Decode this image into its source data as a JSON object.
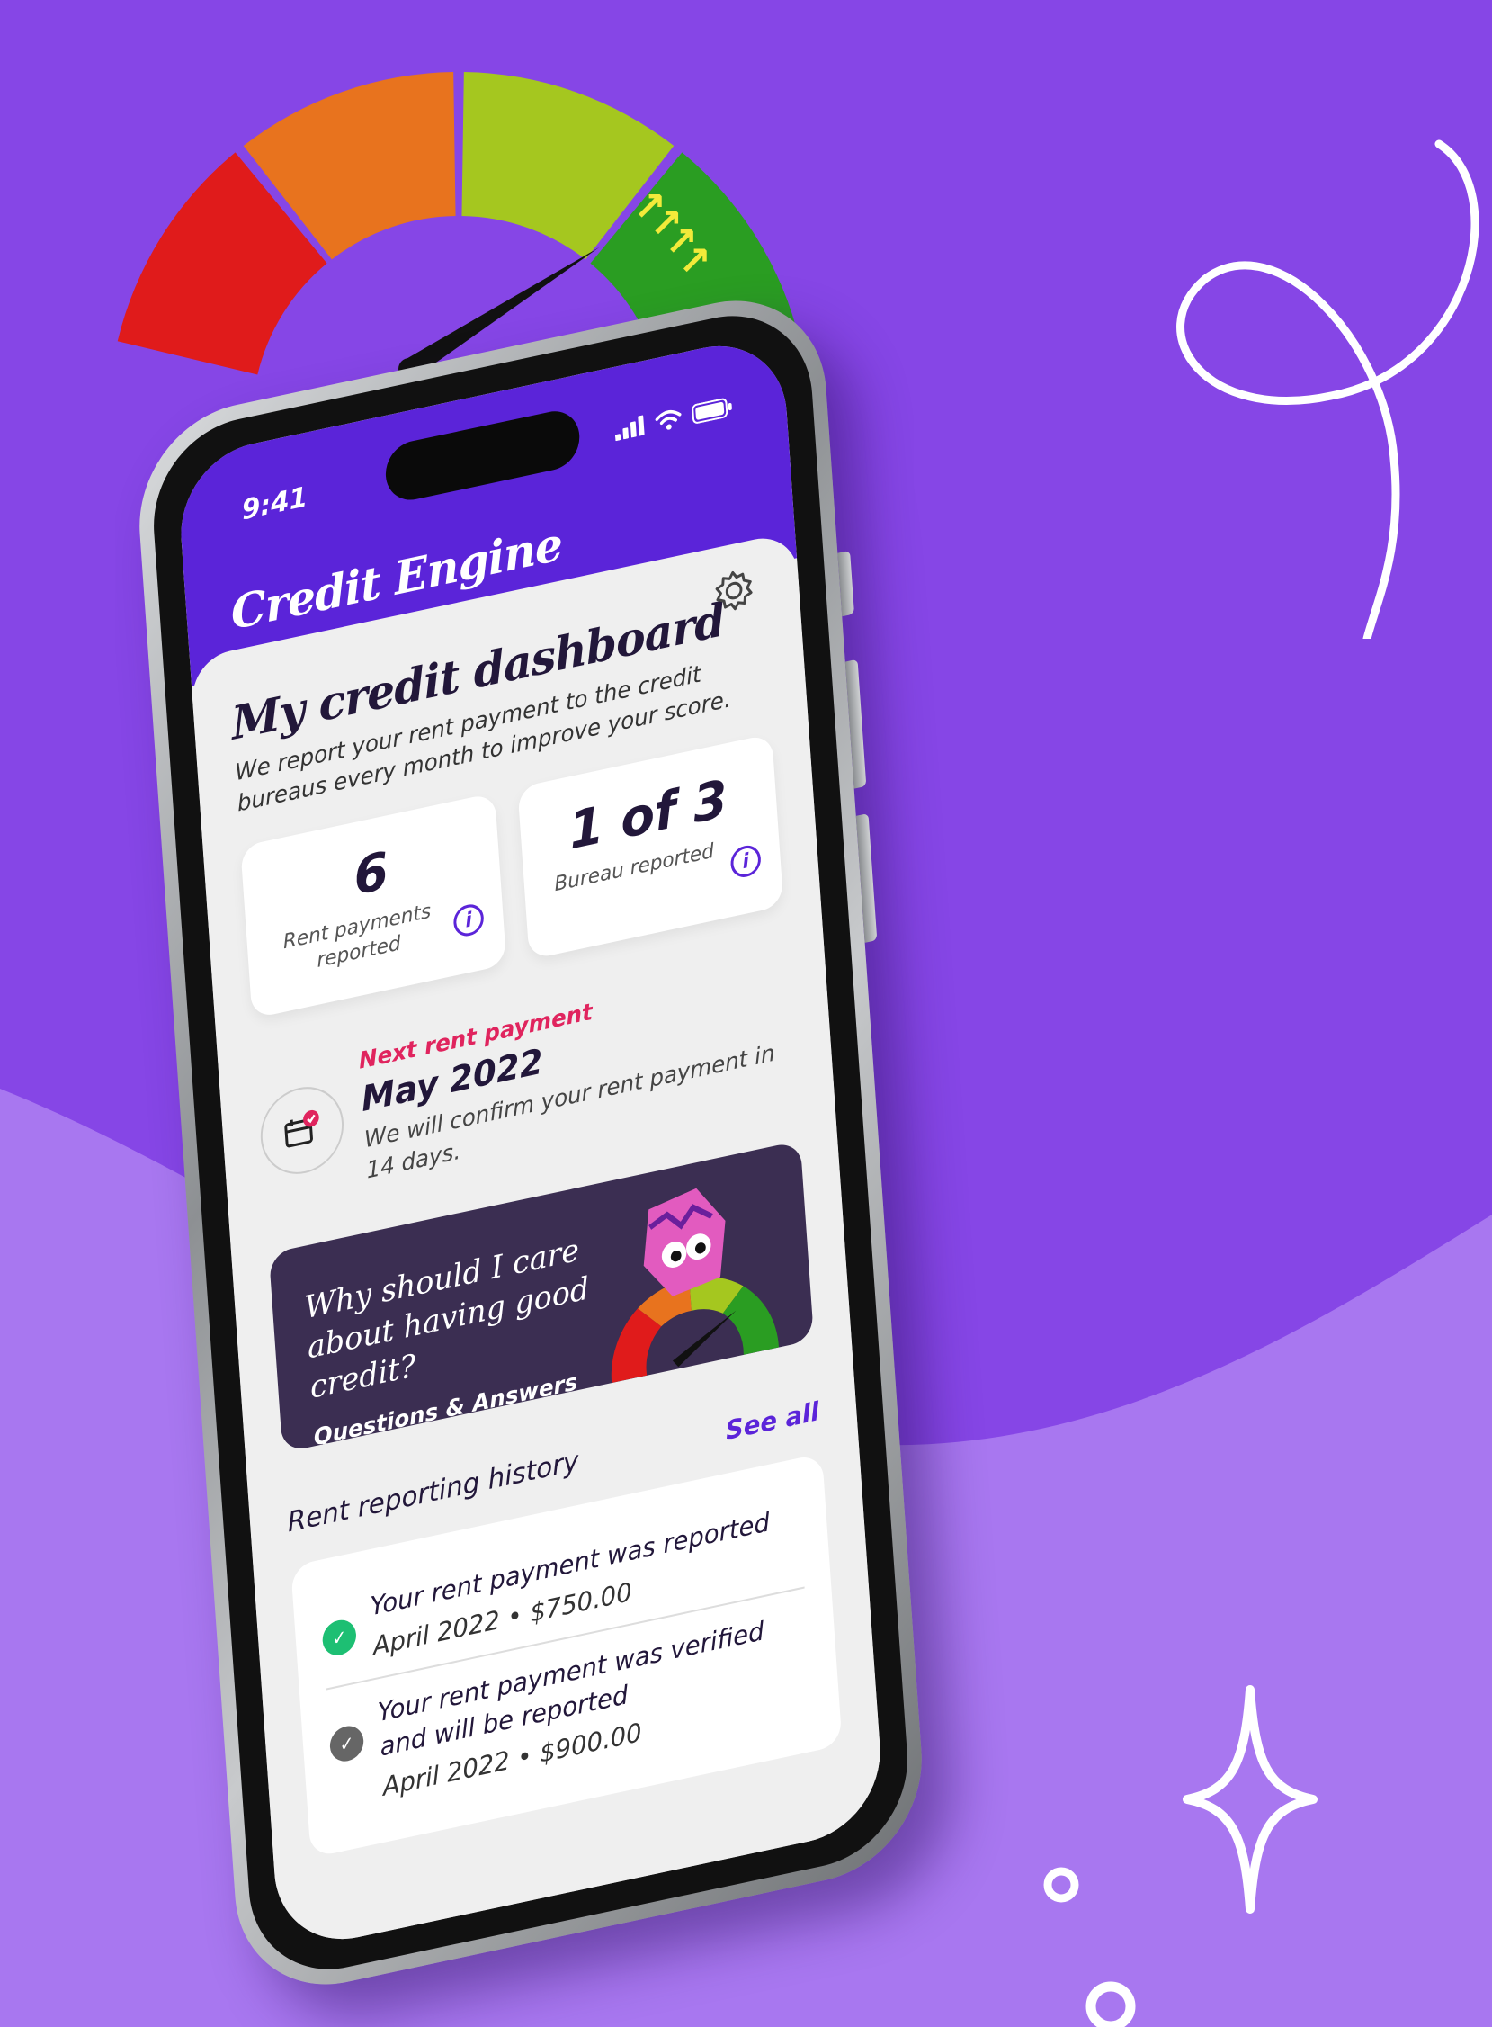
{
  "colors": {
    "background": "#8646e6",
    "wave": "#a877f0",
    "header": "#5b24d9",
    "accent_pink": "#e0245e",
    "promo_bg": "#3b2e52",
    "success": "#1dbf73",
    "neutral_icon": "#666666"
  },
  "gauge": {
    "segments": [
      "#e01b1b",
      "#e8731e",
      "#a5c71f",
      "#2a9d22"
    ],
    "level": 0.75,
    "arrows_icon": "up-right-arrow-icon"
  },
  "status_bar": {
    "time": "9:41",
    "icons": [
      "signal-icon",
      "wifi-icon",
      "battery-icon"
    ]
  },
  "app": {
    "title": "Credit Engine",
    "settings_icon": "gear-icon"
  },
  "dashboard": {
    "title": "My credit dashboard",
    "subtitle": "We report your rent payment to the credit bureaus every month to improve your score."
  },
  "stats": [
    {
      "value": "6",
      "label": "Rent payments reported",
      "icon": "info-icon"
    },
    {
      "value": "1 of 3",
      "label": "Bureau reported",
      "icon": "info-icon"
    }
  ],
  "next_payment": {
    "label": "Next rent payment",
    "month": "May 2022",
    "note": "We will confirm your rent payment in 14 days.",
    "icon": "calendar-check-icon"
  },
  "promo": {
    "title": "Why should I care about having good credit?",
    "link": "Questions & Answers"
  },
  "history": {
    "title": "Rent reporting history",
    "see_all": "See all",
    "items": [
      {
        "text": "Your rent payment was reported",
        "date": "April 2022",
        "amount": "$750.00",
        "status_icon": "check-circle-icon",
        "color": "#1dbf73"
      },
      {
        "text": "Your rent payment was verified and will be reported",
        "date": "April 2022",
        "amount": "$900.00",
        "status_icon": "check-circle-icon",
        "color": "#666666"
      }
    ],
    "separator": "•"
  }
}
